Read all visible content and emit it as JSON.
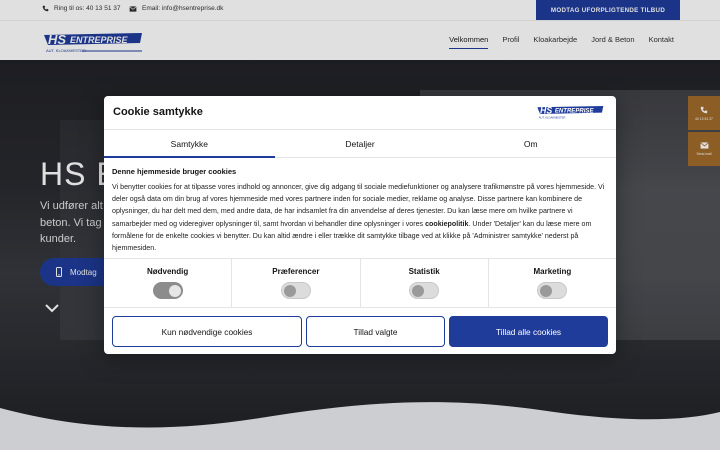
{
  "topbar": {
    "phone": "Ring til os: 40 13 51 37",
    "email": "Email: info@hsentreprise.dk",
    "cta": "MODTAG UFORPLIGTENDE TILBUD"
  },
  "header": {
    "logo_text": "HS ENTREPRISE",
    "logo_sub": "AUT. KLOAKMESTER",
    "nav": [
      "Velkommen",
      "Profil",
      "Kloakarbejde",
      "Jord & Beton",
      "Kontakt"
    ]
  },
  "hero": {
    "title": "HS E",
    "text": "Vi udfører alt\nbeton. Vi tag\nkunder.",
    "button": "Modtag"
  },
  "side_tabs": {
    "phone": "40 13 51 37",
    "mail": "Send mail"
  },
  "cookie": {
    "title": "Cookie samtykke",
    "tabs": [
      "Samtykke",
      "Detaljer",
      "Om"
    ],
    "heading": "Denne hjemmeside bruger cookies",
    "body_1": "Vi benytter cookies for at tilpasse vores indhold og annoncer, give dig adgang til sociale mediefunktioner og analysere trafikmønstre på vores hjemmeside. Vi deler også data om din brug af vores hjemmeside med vores partnere inden for sociale medier, reklame og analyse. Disse partnere kan kombinere de oplysninger, du har delt med dem, med andre data, de har indsamlet fra din anvendelse af deres tjenester. Du kan læse mere om hvilke partnere vi samarbejder med og videregiver oplysninger til, samt hvordan vi behandler dine oplysninger i vores ",
    "body_link": "cookiepolitik",
    "body_2": ". Under 'Detaljer' kan du læse mere om formålene for de enkelte cookies vi benytter. Du kan altid ændre i eller trække dit samtykke tilbage ved at klikke på 'Administrer samtykke' nederst på hjemmesiden.",
    "toggles": [
      "Nødvendig",
      "Præferencer",
      "Statistik",
      "Marketing"
    ],
    "buttons": {
      "necessary": "Kun nødvendige cookies",
      "selected": "Tillad valgte",
      "all": "Tillad alle cookies"
    }
  },
  "colors": {
    "brand_blue": "#1f3c9a",
    "side_tab": "#a06a2a"
  }
}
